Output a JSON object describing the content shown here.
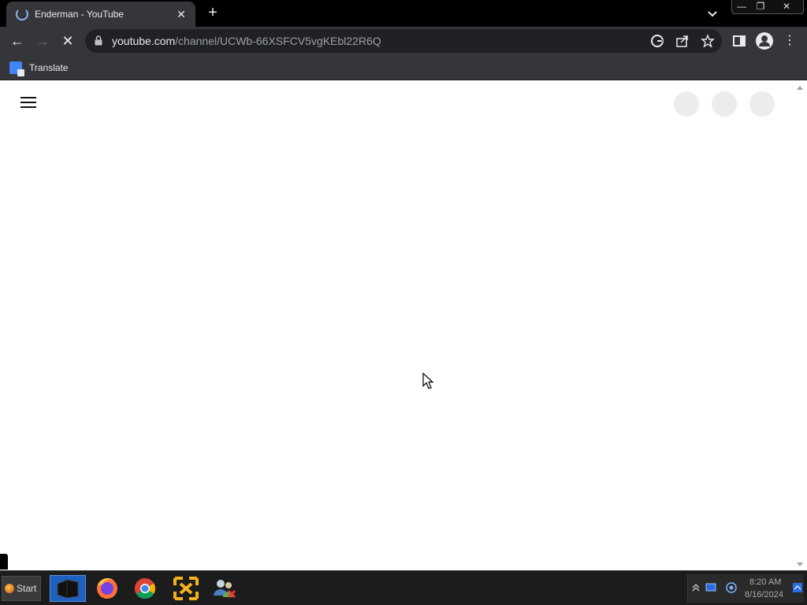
{
  "browser": {
    "tab": {
      "title": "Enderman - YouTube",
      "close_glyph": "✕"
    },
    "new_tab_glyph": "+",
    "window": {
      "minimize": "—",
      "restore": "❐",
      "close": "✕"
    },
    "toolbar": {
      "back_glyph": "←",
      "forward_glyph": "→",
      "reload_glyph": "✕",
      "menu_glyph": "⋮"
    },
    "address": {
      "host": "youtube.com",
      "path": "/channel/UCWb-66XSFCV5vgKEbl22R6Q"
    },
    "bookmarks": [
      {
        "label": "Translate",
        "icon": "google-translate-icon"
      }
    ]
  },
  "page": {
    "state": "loading",
    "header_placeholders": 3
  },
  "taskbar": {
    "start_label": "Start",
    "apps": [
      {
        "name": "file-manager",
        "active": true
      },
      {
        "name": "firefox",
        "active": false
      },
      {
        "name": "chrome",
        "active": false
      },
      {
        "name": "arrows-app",
        "active": false
      },
      {
        "name": "network-users",
        "active": false
      }
    ],
    "clock": {
      "time": "8:20 AM",
      "date": "8/16/2024"
    }
  },
  "colors": {
    "tab_bg": "#35363a",
    "omnibox_bg": "#202124",
    "accent_blue": "#8ab4f8",
    "taskbar_bg": "#1c1c1c"
  }
}
